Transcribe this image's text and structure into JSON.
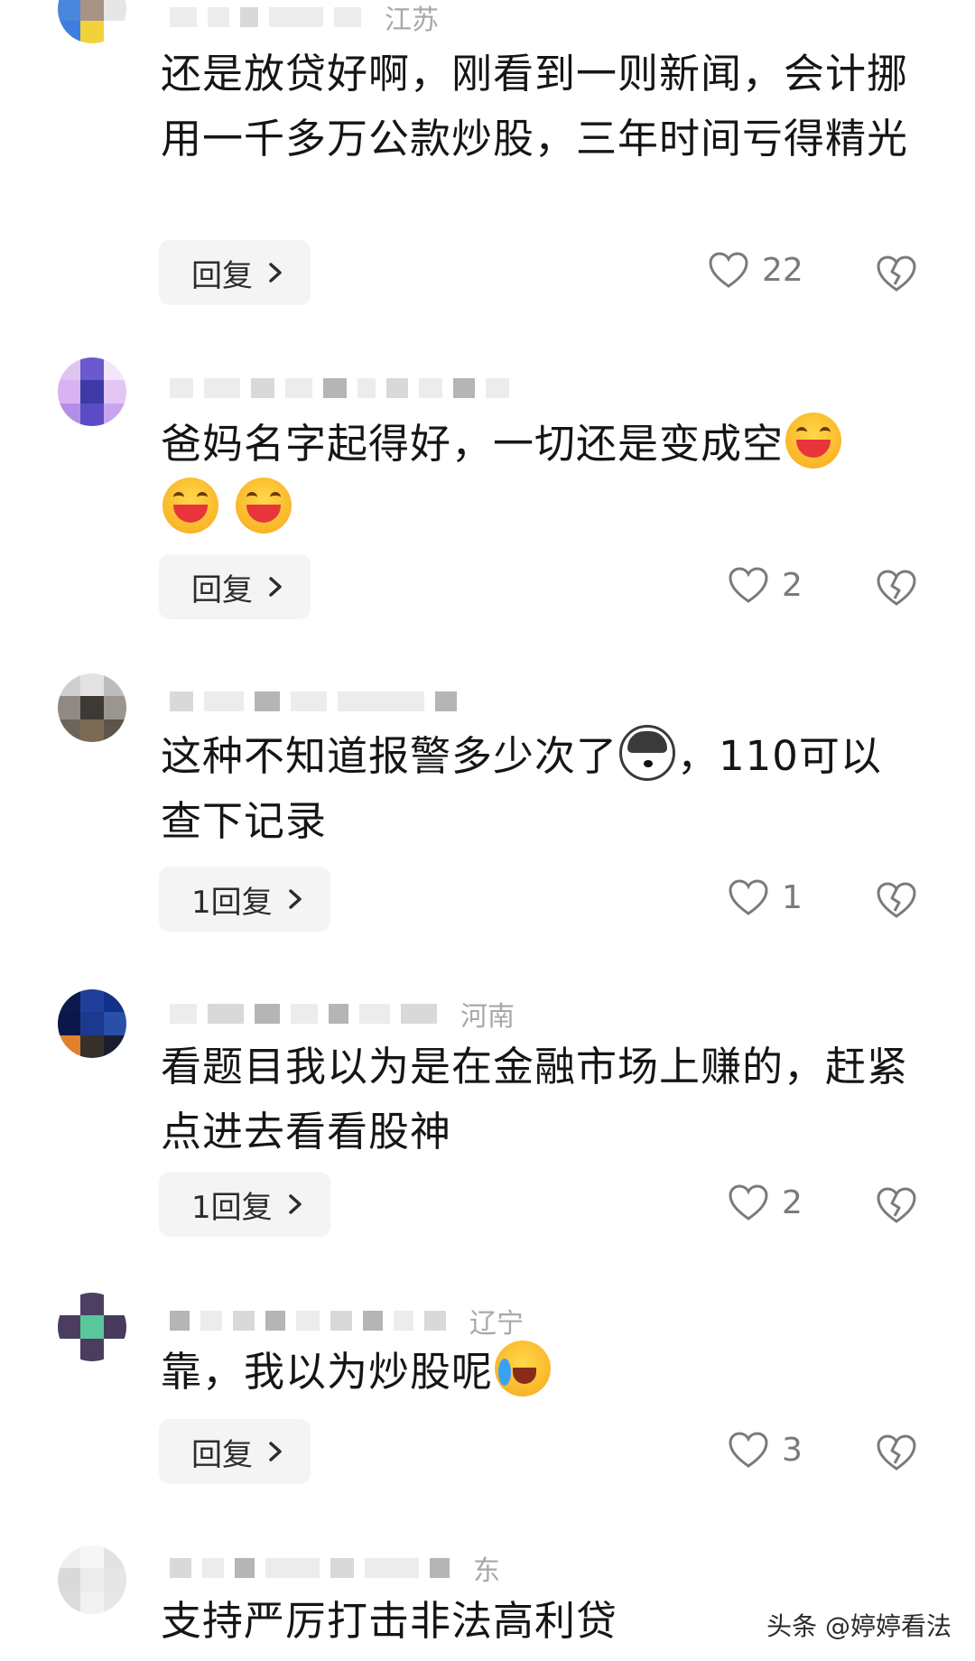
{
  "comments": [
    {
      "location": "江苏",
      "text": "还是放贷好啊，刚看到一则新闻，会计挪用一千多万公款炒股，三年时间亏得精光",
      "reply_label": "回复",
      "like_count": "22"
    },
    {
      "location": "",
      "text": "爸妈名字起得好，一切还是变成空",
      "reply_label": "回复",
      "like_count": "2"
    },
    {
      "location": "",
      "text_before": "这种不知道报警多少次了",
      "text_after": "，110可以查下记录",
      "reply_label": "1回复",
      "like_count": "1"
    },
    {
      "location": "河南",
      "text": "看题目我以为是在金融市场上赚的，赶紧点进去看看股神",
      "reply_label": "1回复",
      "like_count": "2"
    },
    {
      "location": "辽宁",
      "text": "靠，我以为炒股呢",
      "reply_label": "回复",
      "like_count": "3"
    },
    {
      "location": "东",
      "text": "支持严厉打击非法高利贷"
    }
  ],
  "watermark": "头条 @婷婷看法",
  "icons": {
    "like": "heart-outline-icon",
    "dislike": "broken-heart-icon",
    "reply_chevron": "chevron-right-icon",
    "emoji_laugh": "grinning-squinting-emoji",
    "emoji_dog": "husky-dog-emoji",
    "emoji_cry": "rolling-laughing-emoji"
  },
  "colors": {
    "text": "#151515",
    "muted": "#a8a8a8",
    "reply_bg": "#f4f4f4",
    "count": "#7a7a7a"
  }
}
